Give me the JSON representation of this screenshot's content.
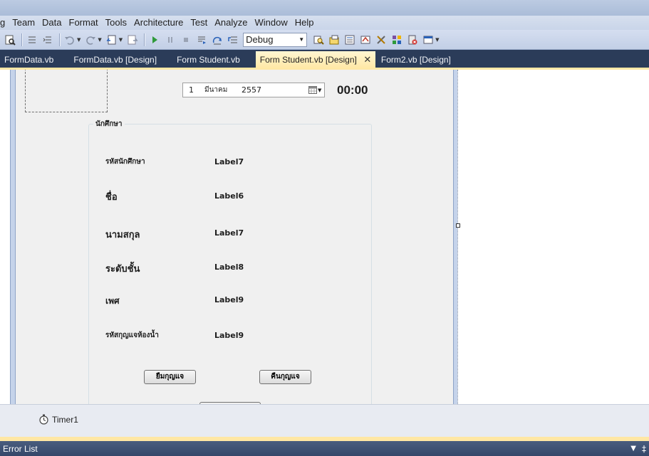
{
  "menu": {
    "items": [
      "g",
      "Team",
      "Data",
      "Format",
      "Tools",
      "Architecture",
      "Test",
      "Analyze",
      "Window",
      "Help"
    ]
  },
  "toolbar": {
    "config_value": "Debug"
  },
  "tabs": [
    {
      "label": "FormData.vb",
      "active": false
    },
    {
      "label": "FormData.vb [Design]",
      "active": false
    },
    {
      "label": "Form Student.vb",
      "active": false
    },
    {
      "label": "Form Student.vb [Design]",
      "active": true
    },
    {
      "label": "Form2.vb [Design]",
      "active": false
    }
  ],
  "form": {
    "date": {
      "day": "1",
      "month": "มีนาคม",
      "year": "2557"
    },
    "clock": "00:00",
    "group_title": "นักศึกษา",
    "fields": [
      {
        "label": "รหัสนักศึกษา",
        "value": "Label7"
      },
      {
        "label": "ชื่อ",
        "value": "Label6"
      },
      {
        "label": "นามสกุล",
        "value": "Label7"
      },
      {
        "label": "ระดับชั้น",
        "value": "Label8"
      },
      {
        "label": "เพศ",
        "value": "Label9"
      },
      {
        "label": "รหัสกุญแจห้องน้ำ",
        "value": "Label9"
      }
    ],
    "borrow_button": "ยืมกุญแจ",
    "return_button": "คืนกุญแจ"
  },
  "tray": {
    "component": "Timer1"
  },
  "bottom_panel": {
    "title": "Error List"
  },
  "colors": {
    "ide_background": "#2b3c59",
    "active_tab": "#ffe8a6",
    "form_surface": "#f0f0f0"
  }
}
